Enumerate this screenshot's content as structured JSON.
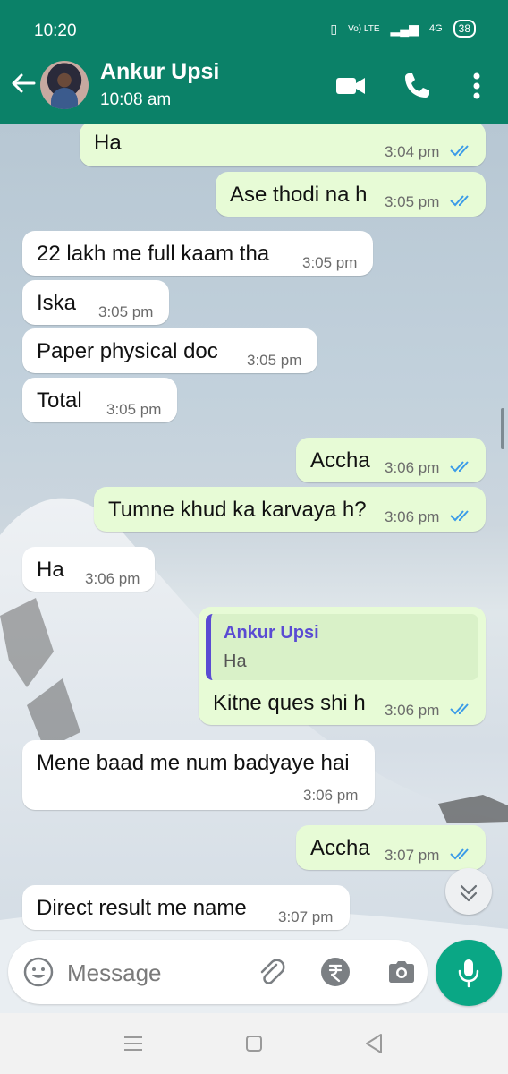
{
  "status": {
    "time": "10:20",
    "network": "Vo) LTE",
    "signal": "4G",
    "battery": "38"
  },
  "header": {
    "contact_name": "Ankur Upsi",
    "last_seen": "10:08 am"
  },
  "messages": [
    {
      "dir": "out",
      "text": "Ha",
      "time": "3:04 pm"
    },
    {
      "dir": "out",
      "text": "Ase thodi na h",
      "time": "3:05 pm"
    },
    {
      "dir": "in",
      "text": "22 lakh me full kaam tha",
      "time": "3:05 pm"
    },
    {
      "dir": "in",
      "text": "Iska",
      "time": "3:05 pm"
    },
    {
      "dir": "in",
      "text": "Paper physical doc",
      "time": "3:05 pm"
    },
    {
      "dir": "in",
      "text": "Total",
      "time": "3:05 pm"
    },
    {
      "dir": "out",
      "text": "Accha",
      "time": "3:06 pm"
    },
    {
      "dir": "out",
      "text": "Tumne khud ka karvaya h?",
      "time": "3:06 pm"
    },
    {
      "dir": "in",
      "text": "Ha",
      "time": "3:06 pm"
    },
    {
      "dir": "out",
      "text": "Kitne ques shi h",
      "time": "3:06 pm",
      "quote": {
        "name": "Ankur Upsi",
        "text": "Ha"
      }
    },
    {
      "dir": "in",
      "text": "Mene baad me num badyaye hai",
      "time": "3:06 pm"
    },
    {
      "dir": "out",
      "text": "Accha",
      "time": "3:07 pm"
    },
    {
      "dir": "in",
      "text": "Direct result me name",
      "time": "3:07 pm"
    }
  ],
  "composer": {
    "placeholder": "Message"
  },
  "colors": {
    "header": "#0b8168",
    "outgoing_bubble": "#e7fbd6",
    "incoming_bubble": "#ffffff",
    "read_ticks": "#3b9be8",
    "mic_button": "#0aa785"
  }
}
